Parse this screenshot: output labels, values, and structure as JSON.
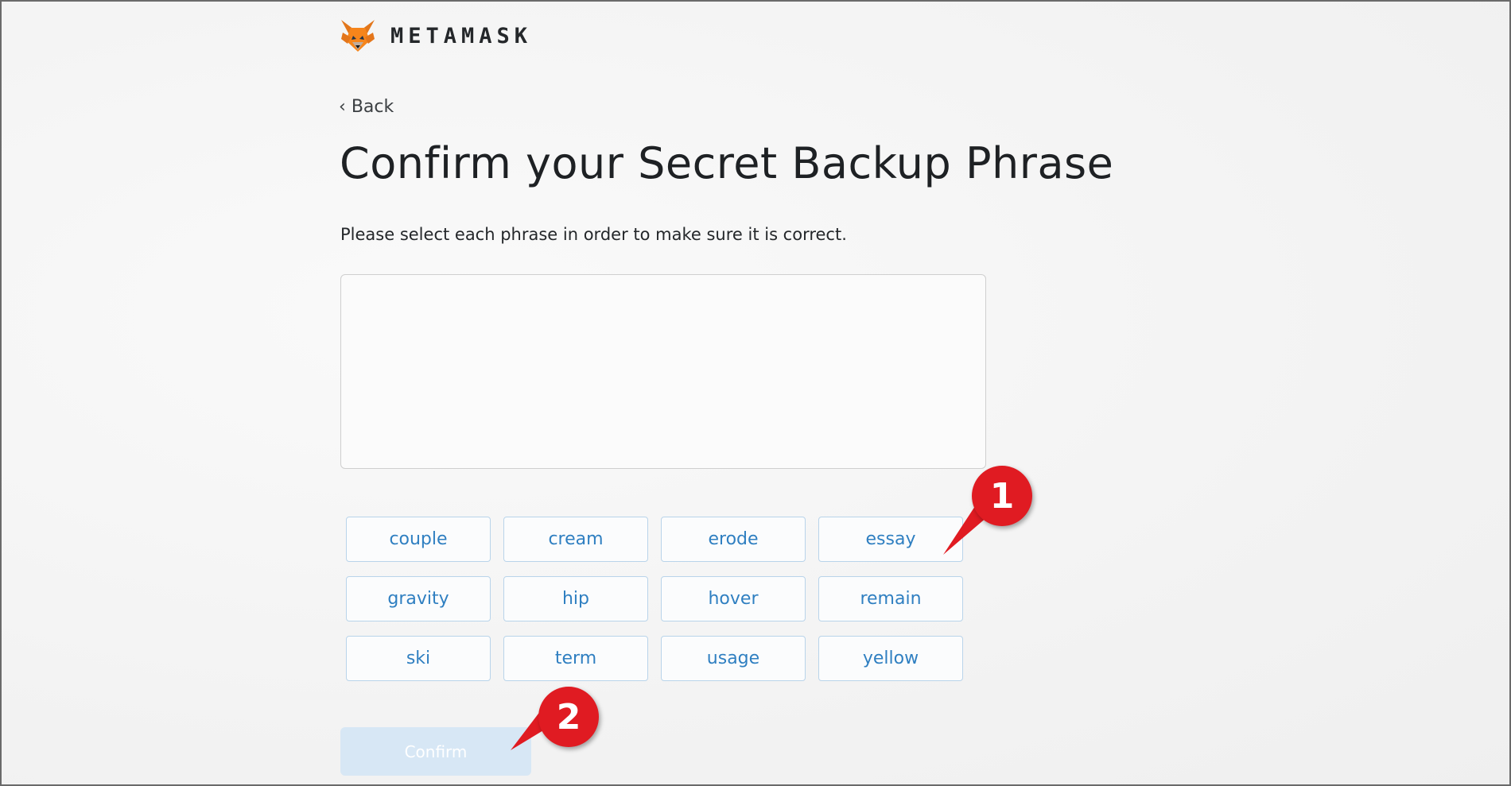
{
  "brand": {
    "name": "METAMASK",
    "logo_icon": "metamask-fox-icon"
  },
  "nav": {
    "back_label": "Back",
    "back_icon": "chevron-left-icon"
  },
  "page": {
    "title": "Confirm your Secret Backup Phrase",
    "instructions": "Please select each phrase in order to make sure it is correct."
  },
  "words": [
    "couple",
    "cream",
    "erode",
    "essay",
    "gravity",
    "hip",
    "hover",
    "remain",
    "ski",
    "term",
    "usage",
    "yellow"
  ],
  "actions": {
    "confirm_label": "Confirm"
  },
  "callouts": [
    "1",
    "2"
  ],
  "colors": {
    "accent": "#2f7fc1",
    "callout": "#e01b22",
    "confirm_disabled": "#d7e7f5"
  }
}
